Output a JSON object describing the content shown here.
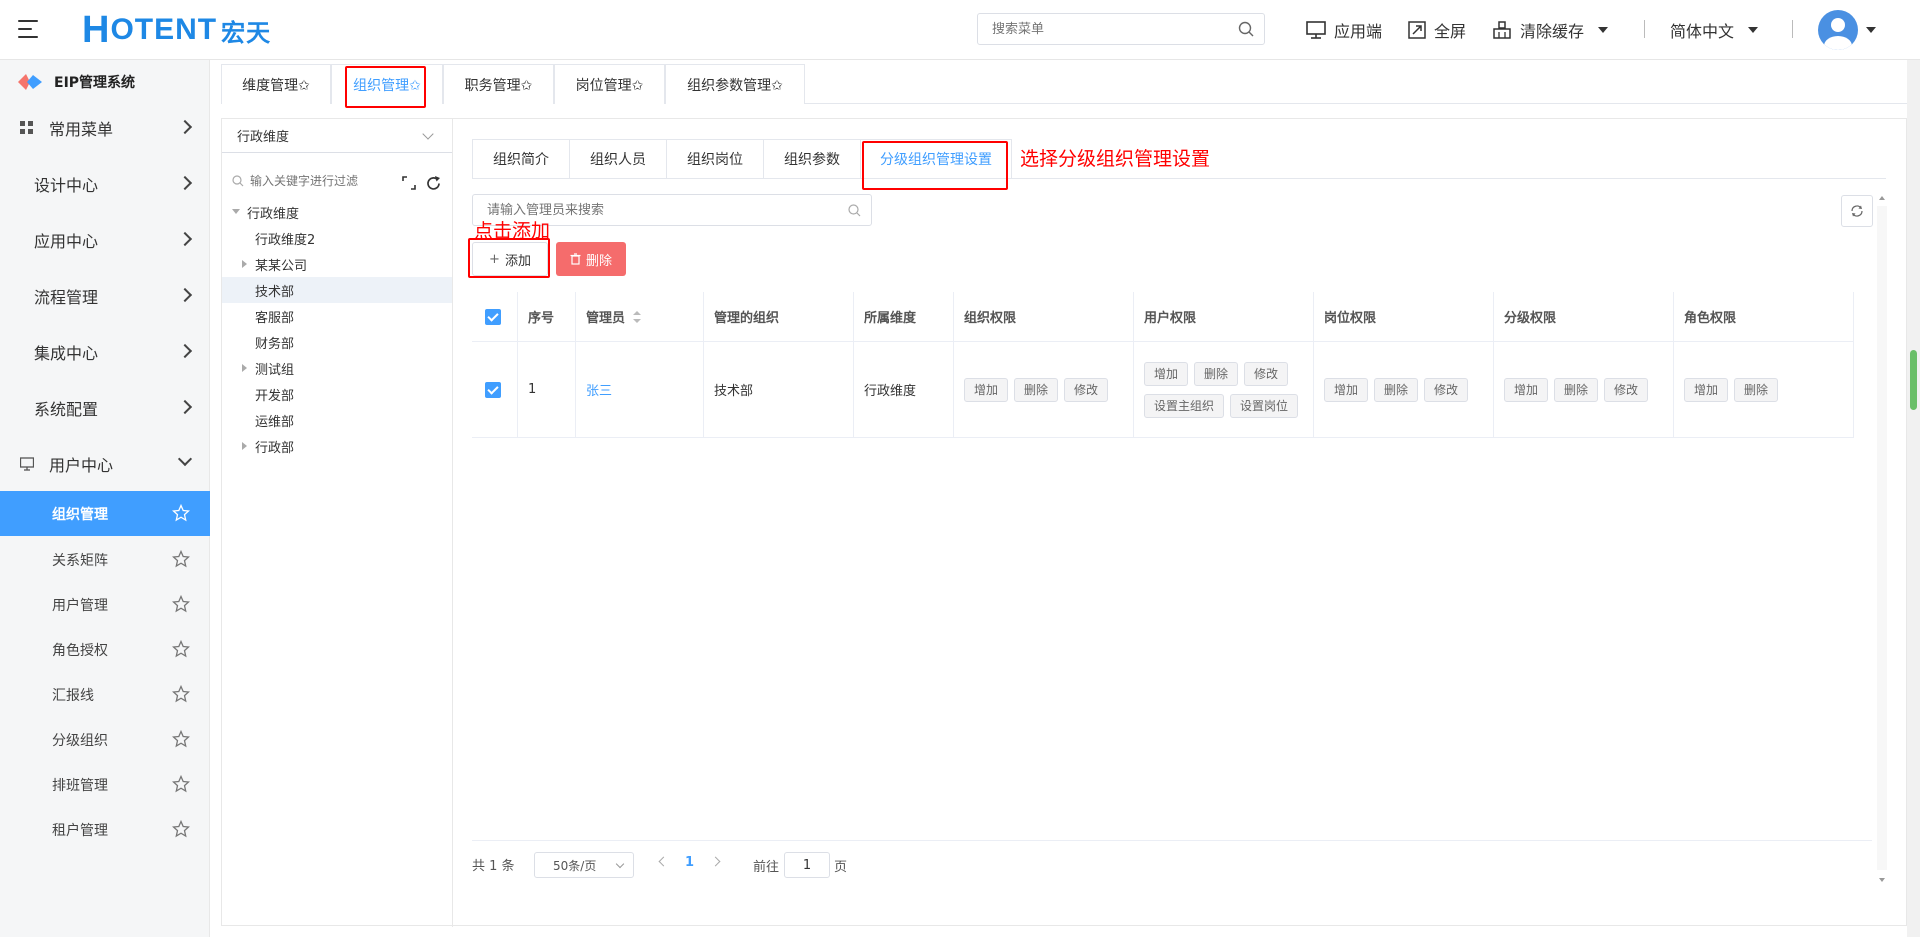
{
  "header": {
    "logo_text_h": "H",
    "logo_text_rest": "OTENT",
    "logo_cn": "宏天",
    "search_placeholder": "搜索菜单",
    "app_end": "应用端",
    "fullscreen": "全屏",
    "clear_cache": "清除缓存",
    "language": "简体中文"
  },
  "sidebar": {
    "system_title": "EIP管理系统",
    "items": [
      {
        "label": "常用菜单"
      },
      {
        "label": "设计中心"
      },
      {
        "label": "应用中心"
      },
      {
        "label": "流程管理"
      },
      {
        "label": "集成中心"
      },
      {
        "label": "系统配置"
      },
      {
        "label": "用户中心"
      }
    ],
    "sub_items": [
      {
        "label": "组织管理"
      },
      {
        "label": "关系矩阵"
      },
      {
        "label": "用户管理"
      },
      {
        "label": "角色授权"
      },
      {
        "label": "汇报线"
      },
      {
        "label": "分级组织"
      },
      {
        "label": "排班管理"
      },
      {
        "label": "租户管理"
      }
    ]
  },
  "top_tabs": [
    {
      "label": "维度管理✩"
    },
    {
      "label": "组织管理✩"
    },
    {
      "label": "职务管理✩"
    },
    {
      "label": "岗位管理✩"
    },
    {
      "label": "组织参数管理✩"
    }
  ],
  "tree": {
    "dimension": "行政维度",
    "search_placeholder": "输入关键字进行过滤",
    "nodes": [
      {
        "label": "行政维度"
      },
      {
        "label": "行政维度2"
      },
      {
        "label": "某某公司"
      },
      {
        "label": "技术部"
      },
      {
        "label": "客服部"
      },
      {
        "label": "财务部"
      },
      {
        "label": "测试组"
      },
      {
        "label": "开发部"
      },
      {
        "label": "运维部"
      },
      {
        "label": "行政部"
      }
    ]
  },
  "sub_tabs": [
    {
      "label": "组织简介"
    },
    {
      "label": "组织人员"
    },
    {
      "label": "组织岗位"
    },
    {
      "label": "组织参数"
    },
    {
      "label": "分级组织管理设置"
    }
  ],
  "annotations": {
    "select_tip": "选择分级组织管理设置",
    "add_tip": "点击添加"
  },
  "toolbar": {
    "search_placeholder": "请输入管理员来搜索",
    "add_label": "添加",
    "delete_label": "删除"
  },
  "table": {
    "headers": [
      "序号",
      "管理员",
      "管理的组织",
      "所属维度",
      "组织权限",
      "用户权限",
      "岗位权限",
      "分级权限",
      "角色权限"
    ],
    "row": {
      "index": "1",
      "admin": "张三",
      "org": "技术部",
      "dimension": "行政维度",
      "org_perms": [
        "增加",
        "删除",
        "修改"
      ],
      "user_perms": [
        "增加",
        "删除",
        "修改",
        "设置主组织",
        "设置岗位"
      ],
      "post_perms": [
        "增加",
        "删除",
        "修改"
      ],
      "grade_perms": [
        "增加",
        "删除",
        "修改"
      ],
      "role_perms": [
        "增加",
        "删除"
      ]
    }
  },
  "pager": {
    "total": "共 1 条",
    "page_size": "50条/页",
    "current": "1",
    "goto_label": "前往",
    "goto_value": "1",
    "page_unit": "页"
  },
  "colors": {
    "primary": "#409eff",
    "danger": "#f56c6c",
    "annotation": "#ff0000",
    "brand": "#1e88e5"
  }
}
